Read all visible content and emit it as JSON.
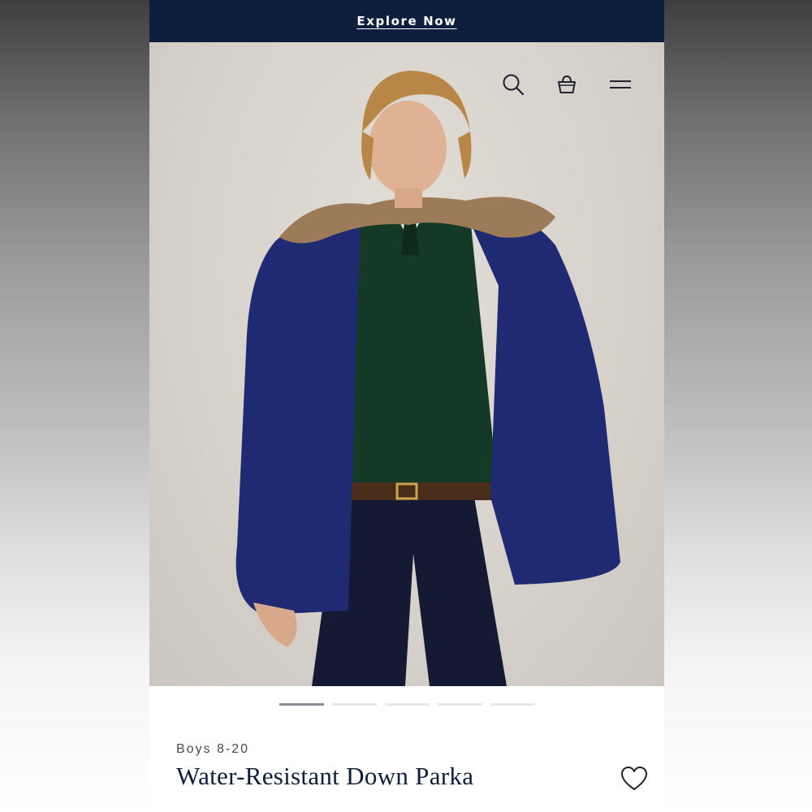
{
  "promo": {
    "link_label": "Explore Now"
  },
  "header": {
    "icons": [
      "search-icon",
      "shopping-bag-icon",
      "menu-icon"
    ]
  },
  "carousel": {
    "count": 5,
    "active_index": 0
  },
  "product": {
    "category": "Boys 8-20",
    "name": "Water-Resistant Down Parka"
  },
  "colors": {
    "navy": "#0d1f3c",
    "backdrop": "#d7d2cb",
    "parka": "#1f2a72",
    "sweater": "#143a27"
  }
}
